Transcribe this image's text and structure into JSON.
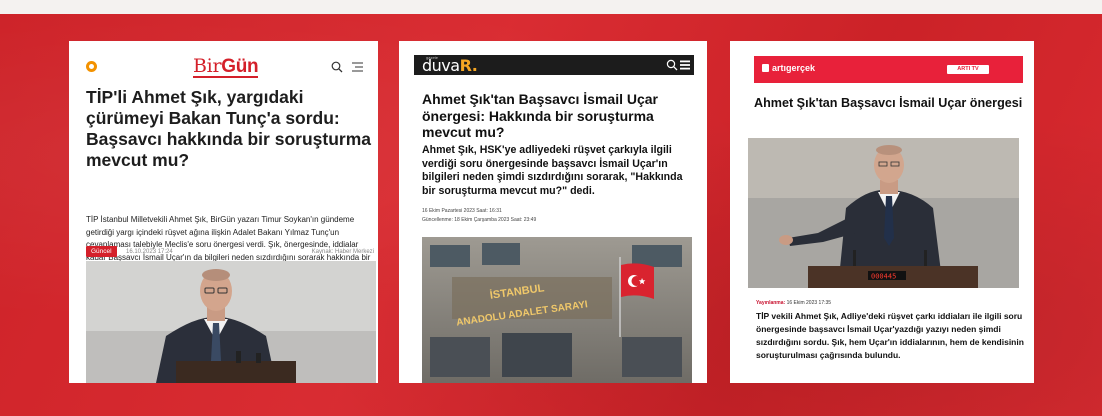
{
  "colors": {
    "background": "#d8242a",
    "birgun_red": "#d4202a",
    "duvar_accent": "#f5a623",
    "artigercek_red": "#e8213a"
  },
  "birgun": {
    "logo_first": "Bir",
    "logo_second": "Gün",
    "icons": [
      "search-icon",
      "menu-icon"
    ],
    "title": "TİP'li Ahmet Şık, yargıdaki çürümeyi Bakan Tunç'a sordu: Başsavcı hakkında bir soruşturma mevcut mu?",
    "lead": "TİP İstanbul Milletvekili Ahmet Şık, BirGün yazarı Timur Soykan'ın gündeme getirdiği yargı içindeki rüşvet ağına ilişkin Adalet Bakanı Yılmaz Tunç'un cevaplaması talebiyle Meclis'e soru önergesi verdi. Şık, önergesinde, iddialar kadar Başsavcı İsmail Uçar'ın da bilgileri neden sızdırdığını sorarak hakkında bir soruşturma olup olmadığını sordu.",
    "tag": "Güncel",
    "date": "16.10.2023 17:24",
    "source": "Kaynak: Haber Merkezi"
  },
  "duvar": {
    "logo_main": "duva",
    "logo_accent": "R.",
    "logo_small": "gazete",
    "icons": [
      "search-icon",
      "menu-icon"
    ],
    "title": "Ahmet Şık'tan Başsavcı İsmail Uçar önergesi: Hakkında bir soruşturma mevcut mu?",
    "lead": "Ahmet Şık, HSK'ye adliyedeki rüşvet çarkıyla ilgili verdiği soru önergesinde başsavcı İsmail Uçar'ın bilgileri neden şimdi sızdırdığını sorarak, \"Hakkında bir soruşturma mevcut mu?\" dedi.",
    "date_line": "16 Ekim Pazartesi 2023   Saat: 16:31",
    "updated_line": "Güncellenme: 18 Ekim Çarşamba 2023   Saat: 23:49",
    "photo_sign_line1": "İSTANBUL",
    "photo_sign_line2": "ANADOLU ADALET SARAYI"
  },
  "artigercek": {
    "logo": "artıgerçek",
    "tv_button": "ARTI TV",
    "title": "Ahmet Şık'tan Başsavcı İsmail Uçar önergesi",
    "vote_display": "000445",
    "published_label": "Yayınlanma:",
    "published_date": "16 Ekim 2023 17:35",
    "lead": "TİP vekili Ahmet Şık, Adliye'deki rüşvet çarkı iddiaları ile ilgili soru önergesinde başsavcı İsmail Uçar'yazdığı yazıyı neden şimdi sızdırdığını sordu. Şık, hem Uçar'ın iddialarının, hem de kendisinin soruşturulması çağrısında bulundu."
  }
}
